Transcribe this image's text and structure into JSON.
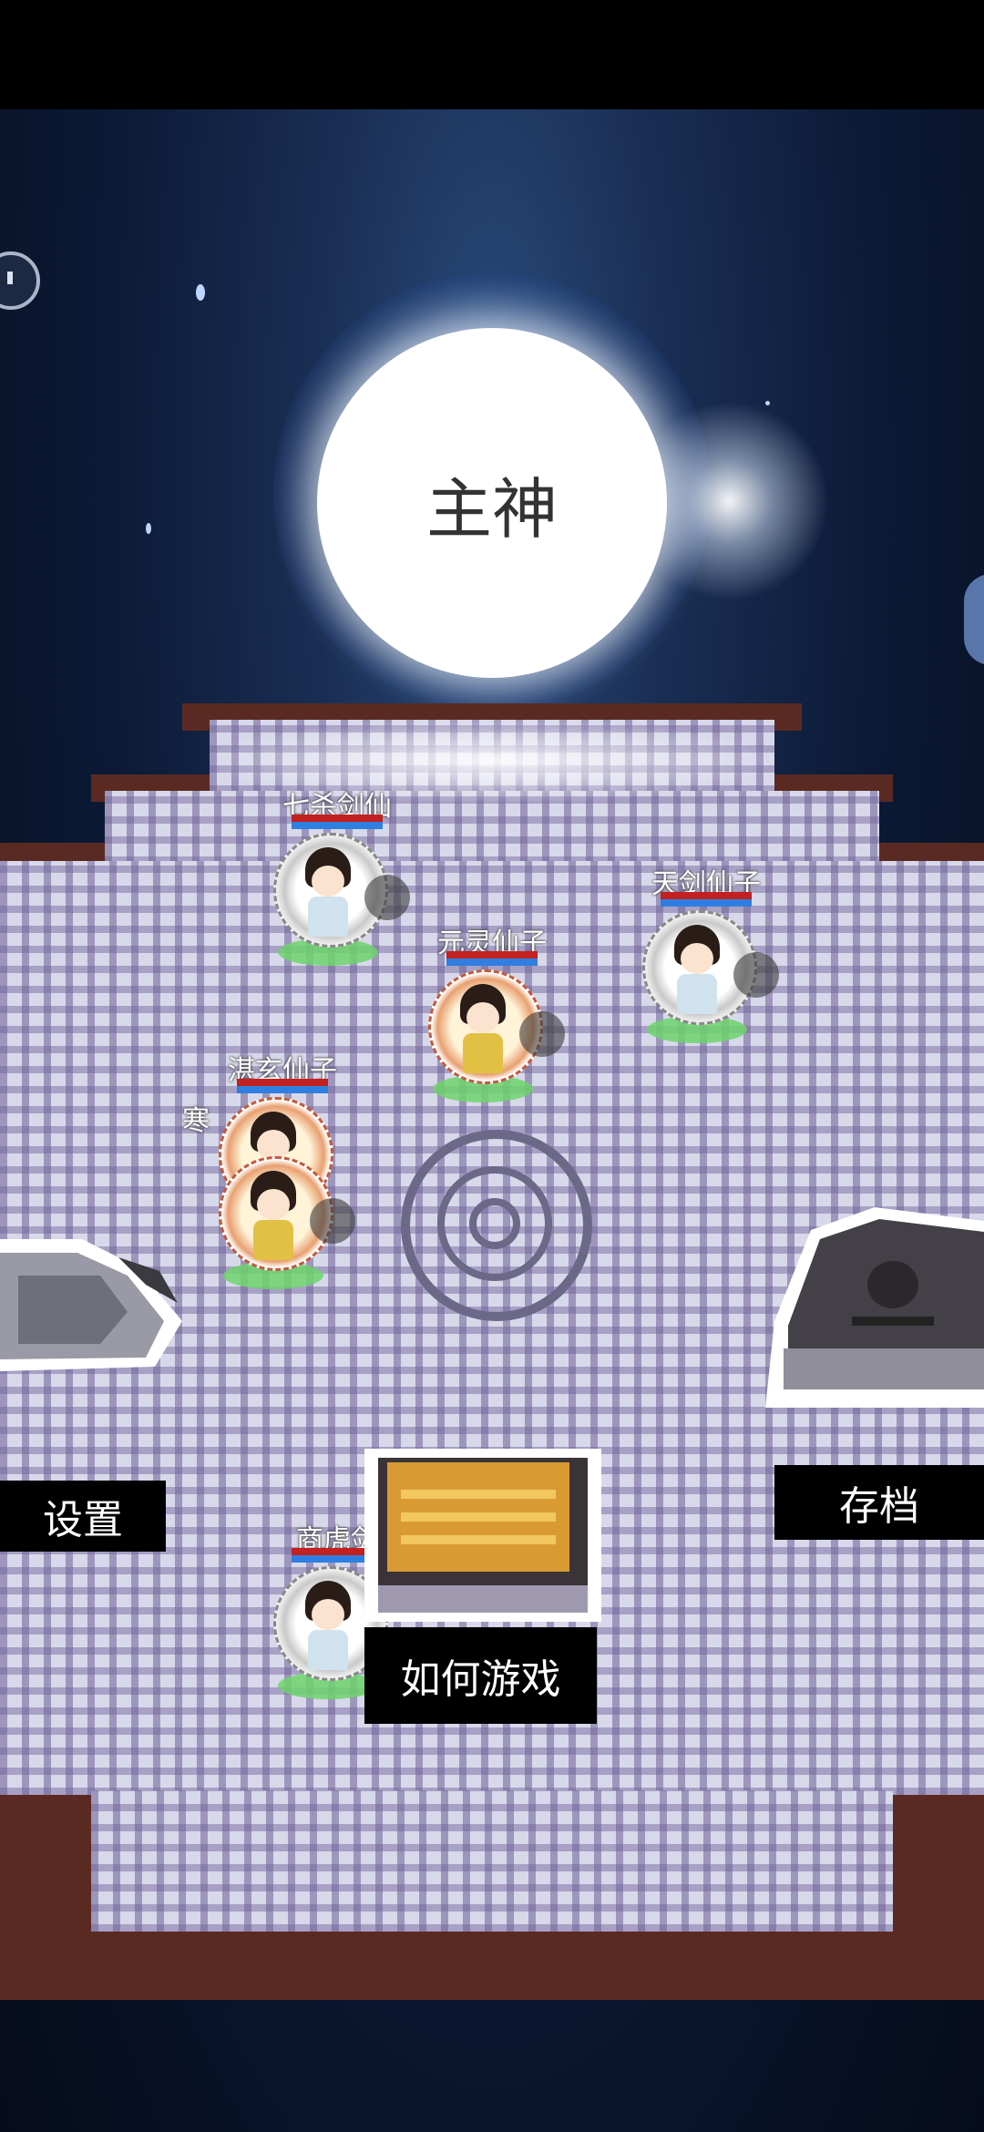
{
  "scene": {
    "center_title": "主神",
    "menu": {
      "settings": "设置",
      "save": "存档",
      "how_to_play": "如何游戏"
    }
  },
  "characters": [
    {
      "name": "七杀剑仙",
      "hp": 1.0,
      "mp": 1.0
    },
    {
      "name": "元灵仙子",
      "hp": 1.0,
      "mp": 1.0
    },
    {
      "name": "天剑仙子",
      "hp": 1.0,
      "mp": 1.0
    },
    {
      "name": "湛玄仙子",
      "hp": 1.0,
      "mp": 1.0
    },
    {
      "name": "寒",
      "hp": 1.0,
      "mp": 1.0
    },
    {
      "name": "商虎剑",
      "hp": 1.0,
      "mp": 1.0
    }
  ],
  "colors": {
    "hp": "#c32020",
    "mp": "#2f7fe0",
    "ground_shadow": "#6fd46c"
  },
  "icons": [
    "pause-icon",
    "settings-statue-icon",
    "save-altar-icon",
    "help-board-icon",
    "target-marker-icon"
  ]
}
